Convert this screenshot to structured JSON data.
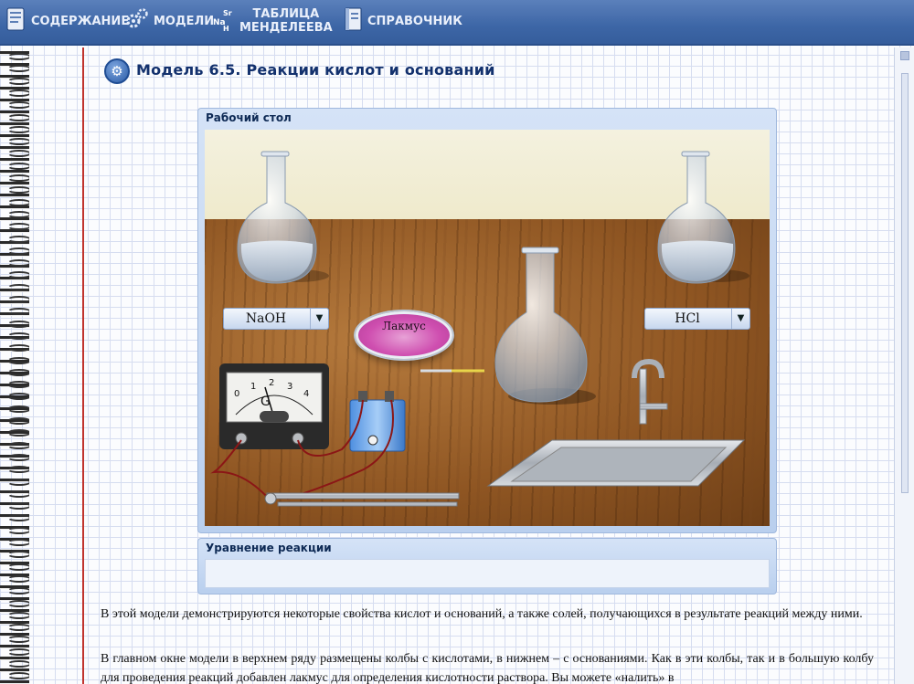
{
  "nav": {
    "contents": "СОДЕРЖАНИЕ",
    "models": "МОДЕЛИ",
    "table_line1": "ТАБЛИЦА",
    "table_line2": "МЕНДЕЛЕЕВА",
    "table_icon_text": "Sr Na H",
    "reference": "СПРАВОЧНИК"
  },
  "page": {
    "title": "Модель 6.5.  Реакции кислот и оснований"
  },
  "workbench": {
    "title": "Рабочий стол",
    "base_select": "NaOH",
    "acid_select": "HCl",
    "litmus_label": "Лакмус",
    "galvanometer_label": "G",
    "galvanometer_scale": [
      "0",
      "1",
      "2",
      "3",
      "4"
    ]
  },
  "equation": {
    "title": "Уравнение реакции",
    "value": ""
  },
  "text": {
    "p1": "В этой модели демонстрируются некоторые свойства кислот и оснований, а также солей, получающихся в результате реакций между ними.",
    "p2": "В главном окне модели в верхнем ряду размещены колбы с кислотами, в нижнем – с основаниями. Как в эти колбы, так и в большую колбу для проведения реакций добавлен лакмус для определения кислотности раствора. Вы можете «налить» в"
  },
  "colors": {
    "nav_bg": "#3d66a6",
    "title_color": "#13316d",
    "litmus": "#cf4fb0",
    "margin_line": "#c0342e"
  }
}
